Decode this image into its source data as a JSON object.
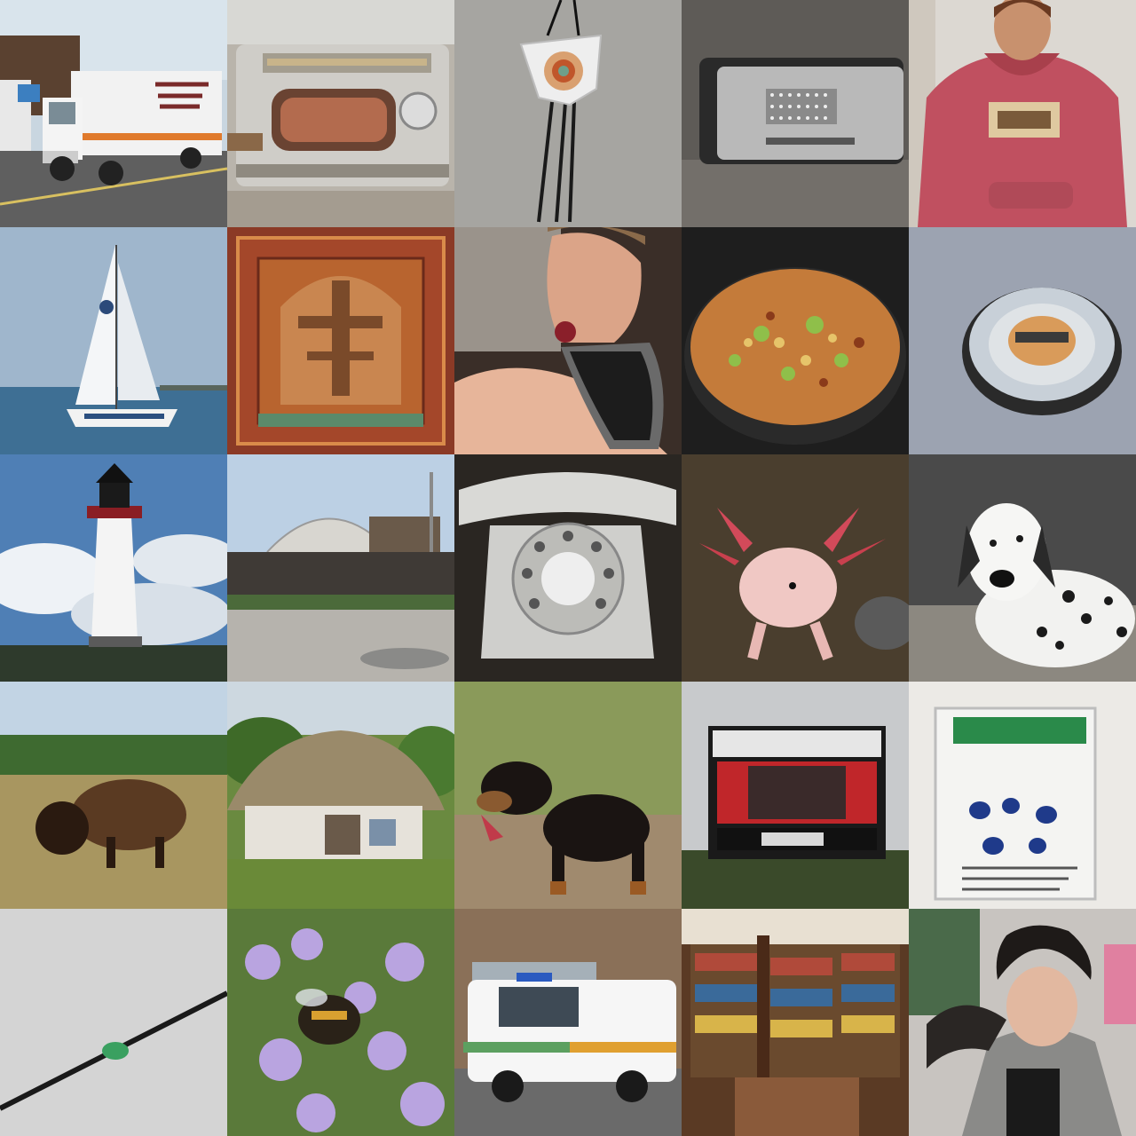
{
  "grid": {
    "rows": 5,
    "columns": 5,
    "tiles": [
      {
        "subject": "moving-truck"
      },
      {
        "subject": "sewing-machine"
      },
      {
        "subject": "bolo-tie"
      },
      {
        "subject": "metal-box"
      },
      {
        "subject": "person-in-red-hoodie"
      },
      {
        "subject": "sailboat"
      },
      {
        "subject": "oriental-rug"
      },
      {
        "subject": "person-eating"
      },
      {
        "subject": "frying-pan-food"
      },
      {
        "subject": "bottle-cap"
      },
      {
        "subject": "lighthouse"
      },
      {
        "subject": "planetarium-dome"
      },
      {
        "subject": "rotary-telephone"
      },
      {
        "subject": "axolotl"
      },
      {
        "subject": "dalmatian"
      },
      {
        "subject": "bison"
      },
      {
        "subject": "thatched-cottage"
      },
      {
        "subject": "rottweiler"
      },
      {
        "subject": "scoreboard"
      },
      {
        "subject": "booklet"
      },
      {
        "subject": "pen"
      },
      {
        "subject": "bee-on-flowers"
      },
      {
        "subject": "ambulance"
      },
      {
        "subject": "bookstore"
      },
      {
        "subject": "person-with-curly-hair"
      }
    ]
  }
}
